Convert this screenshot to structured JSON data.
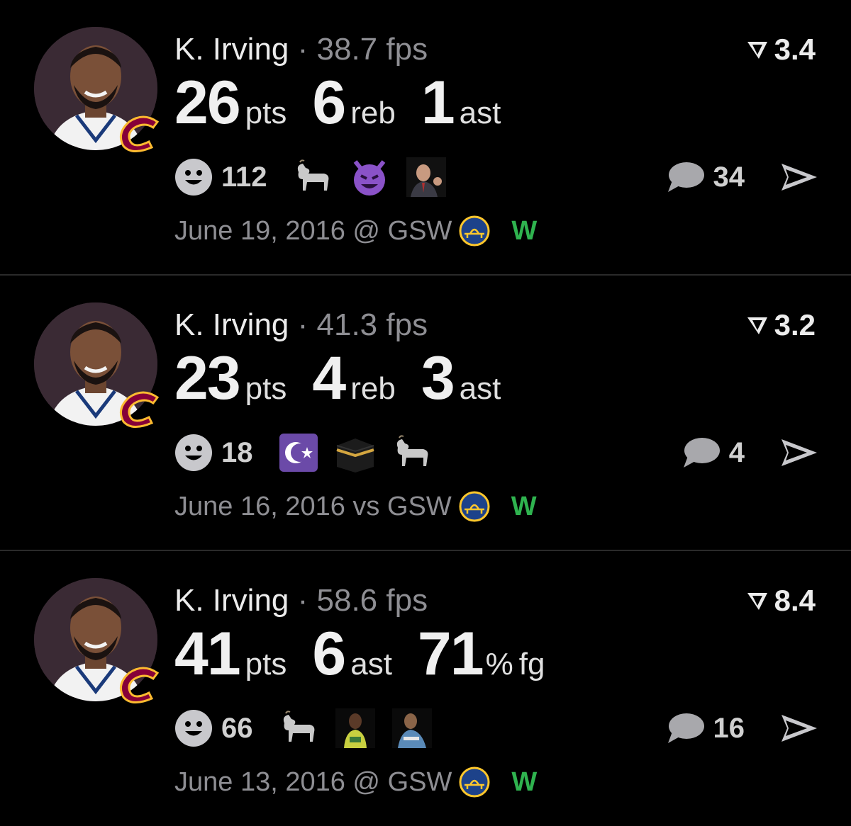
{
  "colors": {
    "background": "#000000",
    "muted": "#8e8e93",
    "win": "#2fb34f",
    "cavs_red": "#860038",
    "cavs_gold": "#fdbb30",
    "warriors_blue": "#1d428a",
    "warriors_gold": "#ffc72c"
  },
  "cards": [
    {
      "player": "K. Irving",
      "separator": "·",
      "fps": "38.7 fps",
      "score": "3.4",
      "stats": [
        {
          "value": "26",
          "unit": "pts"
        },
        {
          "value": "6",
          "unit": "reb"
        },
        {
          "value": "1",
          "unit": "ast"
        }
      ],
      "reaction_count": "112",
      "emojis": [
        "goat-icon",
        "smiling-devil-icon",
        "man-gesturing-icon"
      ],
      "comment_count": "34",
      "date": "June 19, 2016 @ GSW",
      "result": "W"
    },
    {
      "player": "K. Irving",
      "separator": "·",
      "fps": "41.3 fps",
      "score": "3.2",
      "stats": [
        {
          "value": "23",
          "unit": "pts"
        },
        {
          "value": "4",
          "unit": "reb"
        },
        {
          "value": "3",
          "unit": "ast"
        }
      ],
      "reaction_count": "18",
      "emojis": [
        "star-and-crescent-icon",
        "kaaba-icon",
        "goat-icon"
      ],
      "comment_count": "4",
      "date": "June 16, 2016 vs GSW",
      "result": "W"
    },
    {
      "player": "K. Irving",
      "separator": "·",
      "fps": "58.6 fps",
      "score": "8.4",
      "stats": [
        {
          "value": "41",
          "unit": "pts"
        },
        {
          "value": "6",
          "unit": "ast"
        },
        {
          "value": "71",
          "unit": "%",
          "unit2": "fg"
        }
      ],
      "reaction_count": "66",
      "emojis": [
        "goat-icon",
        "player-in-yellow-icon",
        "player-in-blue-icon"
      ],
      "comment_count": "16",
      "date": "June 13, 2016 @ GSW",
      "result": "W"
    }
  ]
}
